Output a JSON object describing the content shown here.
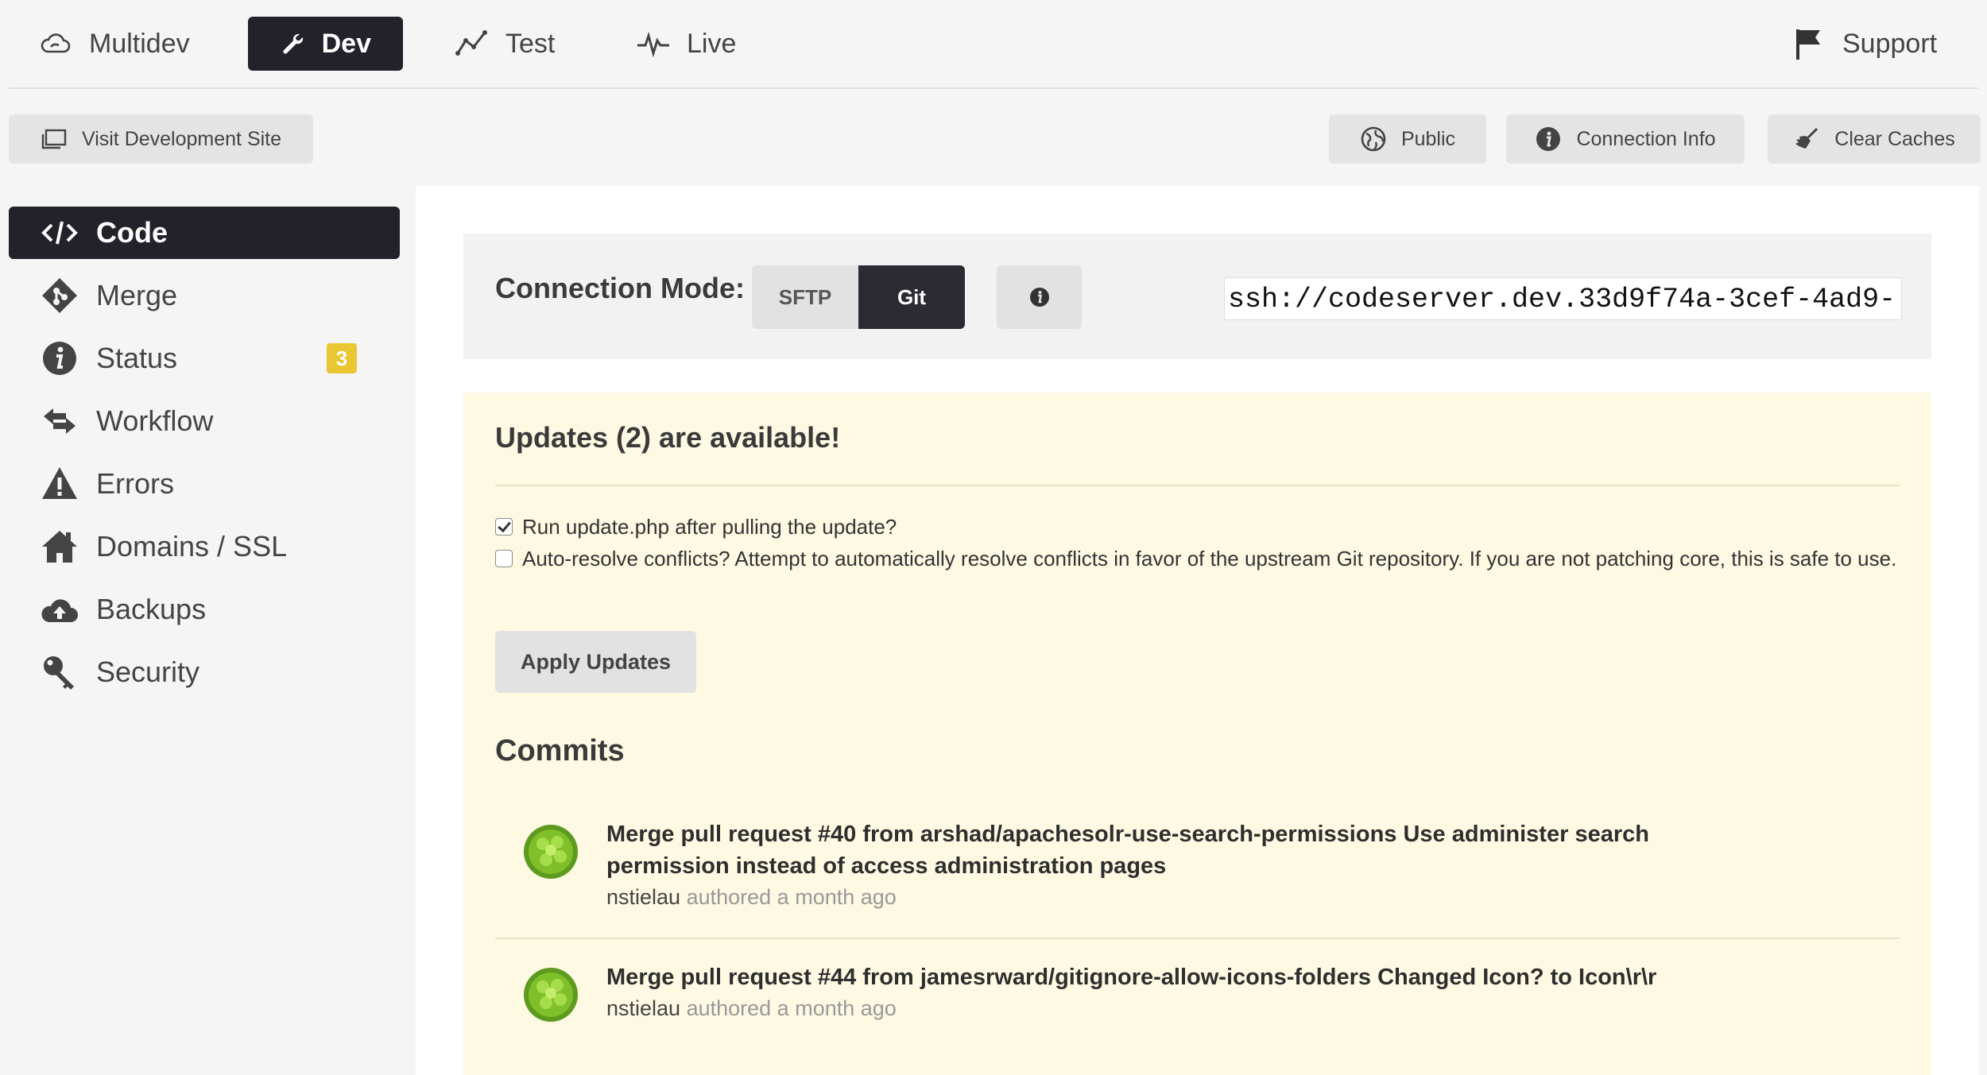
{
  "env_nav": {
    "tabs": [
      {
        "label": "Multidev",
        "icon": "cloud-icon"
      },
      {
        "label": "Dev",
        "icon": "wrench-icon",
        "active": true
      },
      {
        "label": "Test",
        "icon": "line-chart-icon"
      },
      {
        "label": "Live",
        "icon": "pulse-icon"
      }
    ],
    "support_label": "Support"
  },
  "toolbar": {
    "visit_label": "Visit Development Site",
    "public_label": "Public",
    "connection_info_label": "Connection Info",
    "clear_caches_label": "Clear Caches"
  },
  "sidebar": {
    "items": [
      {
        "label": "Code",
        "icon": "code-icon",
        "active": true
      },
      {
        "label": "Merge",
        "icon": "merge-icon"
      },
      {
        "label": "Status",
        "icon": "info-icon",
        "badge": "3"
      },
      {
        "label": "Workflow",
        "icon": "workflow-arrows-icon"
      },
      {
        "label": "Errors",
        "icon": "warning-icon"
      },
      {
        "label": "Domains / SSL",
        "icon": "home-icon"
      },
      {
        "label": "Backups",
        "icon": "cloud-upload-icon"
      },
      {
        "label": "Security",
        "icon": "key-icon"
      }
    ]
  },
  "connection": {
    "label": "Connection Mode:",
    "modes": [
      "SFTP",
      "Git"
    ],
    "selected": "Git",
    "ssh_url": "ssh://codeserver.dev.33d9f74a-3cef-4ad9-"
  },
  "updates": {
    "title": "Updates (2) are available!",
    "run_update_label": "Run update.php after pulling the update?",
    "run_update_checked": true,
    "auto_resolve_label": "Auto-resolve conflicts? Attempt to automatically resolve conflicts in favor of the upstream Git repository. If you are not patching core, this is safe to use.",
    "auto_resolve_checked": false,
    "apply_label": "Apply Updates"
  },
  "commits": {
    "title": "Commits",
    "items": [
      {
        "message": "Merge pull request #40 from arshad/apachesolr-use-search-permissions Use administer search permission instead of access administration pages",
        "author": "nstielau",
        "meta": "authored a month ago"
      },
      {
        "message": "Merge pull request #44 from jamesrward/gitignore-allow-icons-folders Changed Icon? to Icon\\r\\r",
        "author": "nstielau",
        "meta": "authored a month ago"
      }
    ]
  },
  "colors": {
    "dark": "#23222b",
    "badge": "#e9c632",
    "updates_bg": "#fdf9e3"
  }
}
